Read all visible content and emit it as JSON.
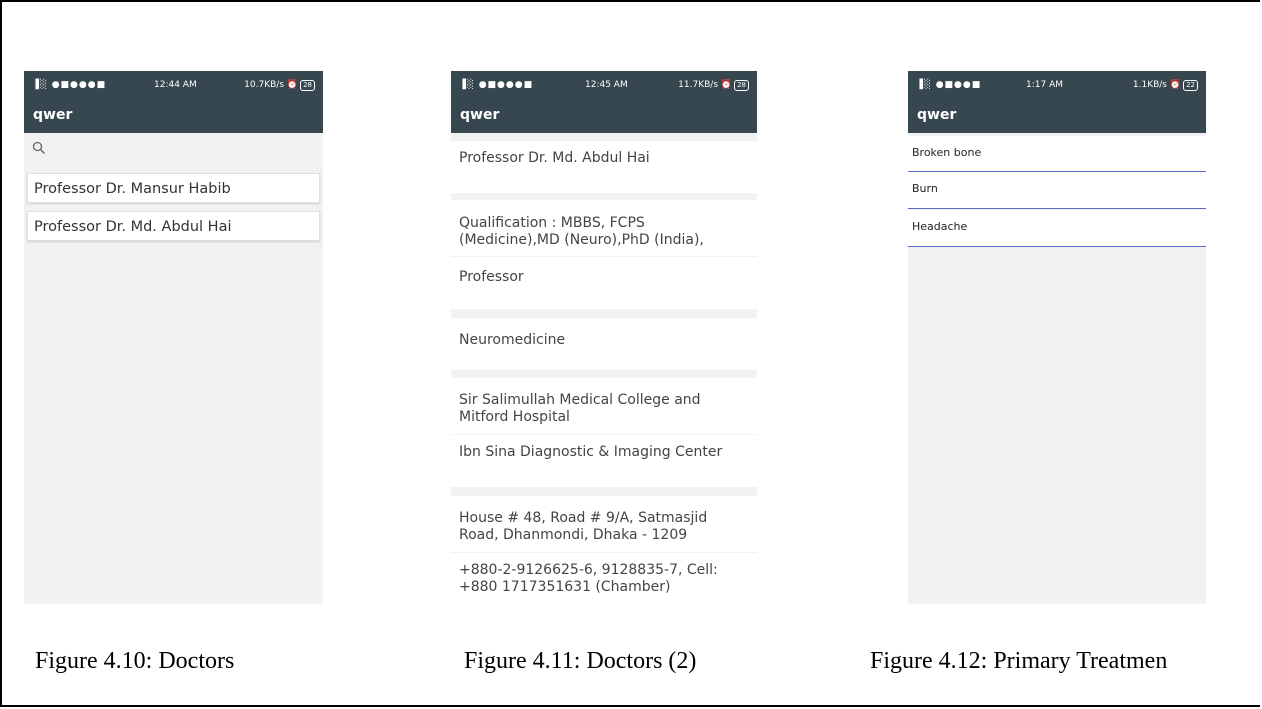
{
  "phones": [
    {
      "status": {
        "icons": "▐░ ●■●●●■",
        "time": "12:44 AM",
        "speed": "10.7KB/s ⏰",
        "battery": "28"
      },
      "app_title": "qwer",
      "search_icon": "search-icon",
      "items": [
        "Professor Dr. Mansur Habib",
        "Professor Dr. Md. Abdul Hai"
      ]
    },
    {
      "status": {
        "icons": "▐░ ●■●●●■",
        "time": "12:45 AM",
        "speed": "11.7KB/s ⏰",
        "battery": "28"
      },
      "app_title": "qwer",
      "details": {
        "name": "Professor Dr. Md. Abdul Hai",
        "qualification": "Qualification : MBBS, FCPS (Medicine),MD (Neuro),PhD (India),",
        "designation": "Professor",
        "specialty": "Neuromedicine",
        "institute": "Sir Salimullah Medical College and Mitford Hospital",
        "chamber": "Ibn Sina Diagnostic & Imaging Center",
        "address": "House # 48, Road # 9/A, Satmasjid Road, Dhanmondi, Dhaka - 1209",
        "phone": "+880-2-9126625-6, 9128835-7, Cell: +880 1717351631 (Chamber)"
      }
    },
    {
      "status": {
        "icons": "▐░ ●■●●■",
        "time": "1:17 AM",
        "speed": "1.1KB/s ⏰",
        "battery": "22"
      },
      "app_title": "qwer",
      "items": [
        "Broken bone",
        "Burn",
        "Headache"
      ]
    }
  ],
  "captions": [
    "Figure 4.10: Doctors",
    "Figure 4.11: Doctors (2)",
    "Figure 4.12: Primary Treatmen"
  ]
}
